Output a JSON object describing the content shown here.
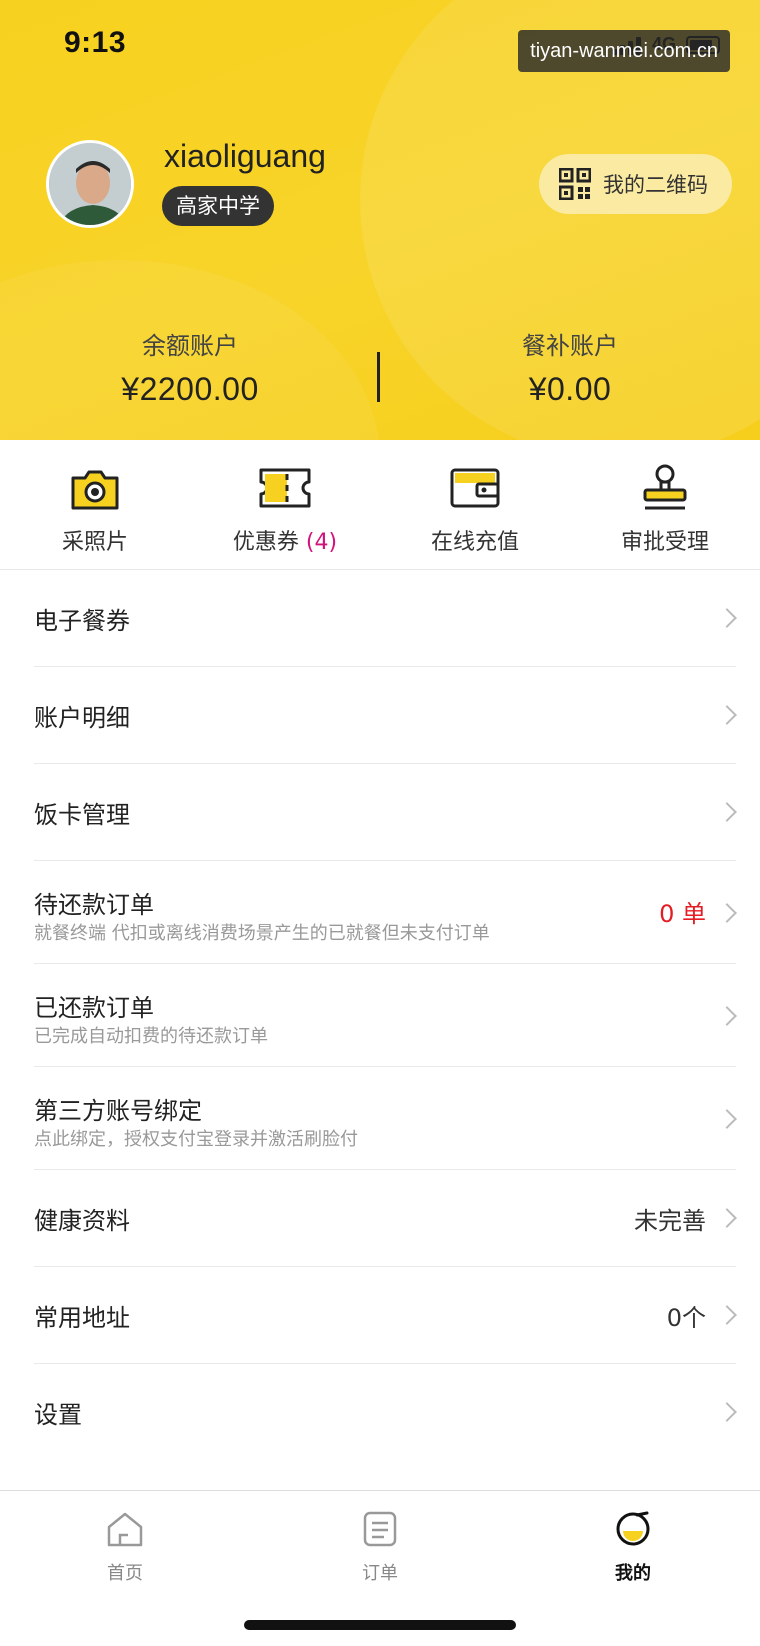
{
  "status_bar": {
    "time": "9:13",
    "network": "4G"
  },
  "watermark": "tiyan-wanmei.com.cn",
  "profile": {
    "username": "xiaoliguang",
    "school": "高家中学",
    "qr_button_label": "我的二维码"
  },
  "balances": {
    "balance": {
      "label": "余额账户",
      "value": "¥2200.00"
    },
    "meal_subsidy": {
      "label": "餐补账户",
      "value": "¥0.00"
    }
  },
  "actions": [
    {
      "label": "采照片",
      "icon": "camera-icon"
    },
    {
      "label": "优惠券",
      "count": "(4)",
      "icon": "ticket-icon"
    },
    {
      "label": "在线充值",
      "icon": "wallet-icon"
    },
    {
      "label": "审批受理",
      "icon": "stamp-icon"
    }
  ],
  "menu": [
    {
      "title": "电子餐券"
    },
    {
      "title": "账户明细"
    },
    {
      "title": "饭卡管理"
    },
    {
      "title": "待还款订单",
      "subtitle": "就餐终端 代扣或离线消费场景产生的已就餐但未支付订单",
      "value": "0 单"
    },
    {
      "title": "已还款订单",
      "subtitle": "已完成自动扣费的待还款订单"
    },
    {
      "title": "第三方账号绑定",
      "subtitle": "点此绑定，授权支付宝登录并激活刷脸付"
    },
    {
      "title": "健康资料",
      "value": "未完善"
    },
    {
      "title": "常用地址",
      "value": "0个"
    },
    {
      "title": "设置"
    }
  ],
  "tabs": [
    {
      "label": "首页",
      "icon": "home-icon"
    },
    {
      "label": "订单",
      "icon": "orders-icon"
    },
    {
      "label": "我的",
      "icon": "mine-icon",
      "active": true
    }
  ],
  "colors": {
    "brand_yellow": "#f7d11f",
    "badge_dark": "#333333",
    "alert_red": "#e51c23",
    "coupon_count": "#d0147a"
  }
}
